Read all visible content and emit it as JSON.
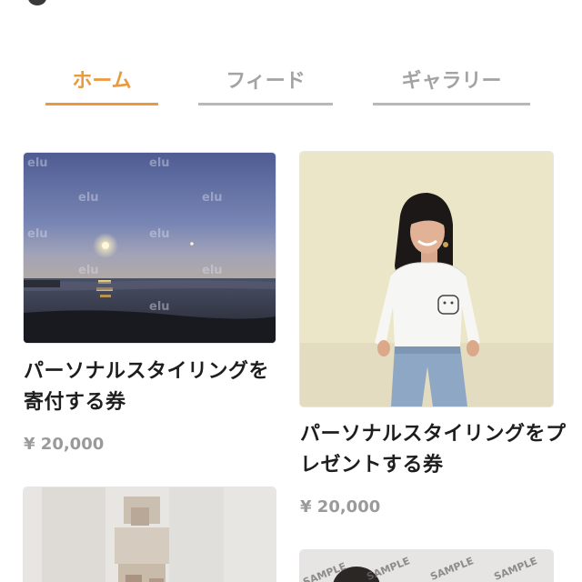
{
  "tabs": [
    {
      "label": "ホーム",
      "active": true
    },
    {
      "label": "フィード",
      "active": false
    },
    {
      "label": "ギャラリー",
      "active": false
    }
  ],
  "colors": {
    "accent": "#e99a3e",
    "inactive_tab": "#a3a3a3",
    "price": "#9a9a9a",
    "title": "#1e1e1e"
  },
  "items": [
    {
      "title": "パーソナルスタイリングを寄付する券",
      "price": "¥ 20,000",
      "watermark": "elu"
    },
    {
      "title": "パーソナルスタイリングをプレゼントする券",
      "price": "¥ 20,000"
    },
    {
      "title": "",
      "price": ""
    },
    {
      "title": "",
      "price": "",
      "watermark": "SAMPLE"
    }
  ]
}
